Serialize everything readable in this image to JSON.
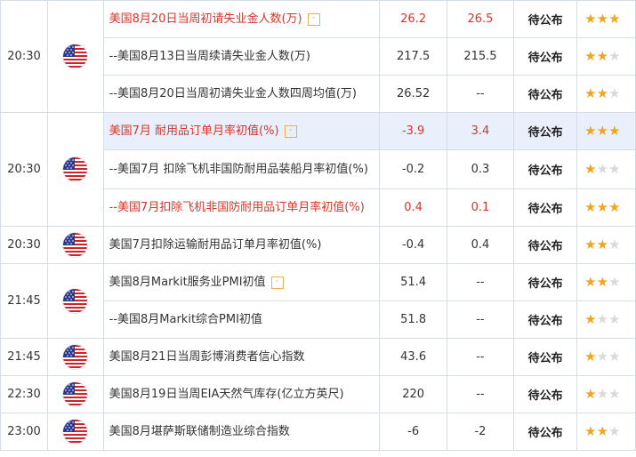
{
  "groups": [
    {
      "time": "20:30",
      "rows": [
        {
          "name": "美国8月20日当周初请失业金人数(万)",
          "prev": "26.2",
          "forecast": "26.5",
          "status": "待公布",
          "stars": 3,
          "red": true,
          "info": true,
          "highlight": false
        },
        {
          "name": "--美国8月13日当周续请失业金人数(万)",
          "prev": "217.5",
          "forecast": "215.5",
          "status": "待公布",
          "stars": 2,
          "red": false,
          "info": false,
          "highlight": false
        },
        {
          "name": "--美国8月20日当周初请失业金人数四周均值(万)",
          "prev": "26.52",
          "forecast": "--",
          "status": "待公布",
          "stars": 2,
          "red": false,
          "info": false,
          "highlight": false
        }
      ]
    },
    {
      "time": "20:30",
      "rows": [
        {
          "name": "美国7月 耐用品订单月率初值(%)",
          "prev": "-3.9",
          "forecast": "3.4",
          "status": "待公布",
          "stars": 3,
          "red": true,
          "info": true,
          "highlight": true
        },
        {
          "name": "--美国7月 扣除飞机非国防耐用品装船月率初值(%)",
          "prev": "-0.2",
          "forecast": "0.3",
          "status": "待公布",
          "stars": 1,
          "red": false,
          "info": false,
          "highlight": false
        },
        {
          "name": "--美国7月扣除飞机非国防耐用品订单月率初值(%)",
          "prev": "0.4",
          "forecast": "0.1",
          "status": "待公布",
          "stars": 3,
          "red": true,
          "info": false,
          "highlight": false
        }
      ]
    },
    {
      "time": "20:30",
      "rows": [
        {
          "name": "美国7月扣除运输耐用品订单月率初值(%)",
          "prev": "-0.4",
          "forecast": "0.4",
          "status": "待公布",
          "stars": 2,
          "red": false,
          "info": false,
          "highlight": false
        }
      ]
    },
    {
      "time": "21:45",
      "rows": [
        {
          "name": "美国8月Markit服务业PMI初值",
          "prev": "51.4",
          "forecast": "--",
          "status": "待公布",
          "stars": 2,
          "red": false,
          "info": true,
          "highlight": false
        },
        {
          "name": "--美国8月Markit综合PMI初值",
          "prev": "51.8",
          "forecast": "--",
          "status": "待公布",
          "stars": 1,
          "red": false,
          "info": false,
          "highlight": false
        }
      ]
    },
    {
      "time": "21:45",
      "rows": [
        {
          "name": "美国8月21日当周彭博消费者信心指数",
          "prev": "43.6",
          "forecast": "--",
          "status": "待公布",
          "stars": 1,
          "red": false,
          "info": false,
          "highlight": false
        }
      ]
    },
    {
      "time": "22:30",
      "rows": [
        {
          "name": "美国8月19日当周EIA天然气库存(亿立方英尺)",
          "prev": "220",
          "forecast": "--",
          "status": "待公布",
          "stars": 1,
          "red": false,
          "info": false,
          "highlight": false
        }
      ]
    },
    {
      "time": "23:00",
      "rows": [
        {
          "name": "美国8月堪萨斯联储制造业综合指数",
          "prev": "-6",
          "forecast": "-2",
          "status": "待公布",
          "stars": 2,
          "red": false,
          "info": false,
          "highlight": false
        }
      ]
    }
  ],
  "icons": {
    "flag": "us-flag-icon",
    "info": "info-icon",
    "star": "star-icon"
  },
  "colors": {
    "red": "#d8342a",
    "star_on": "#f2a51e",
    "star_off": "#d9d9d9",
    "highlight": "#eaf0fb"
  }
}
